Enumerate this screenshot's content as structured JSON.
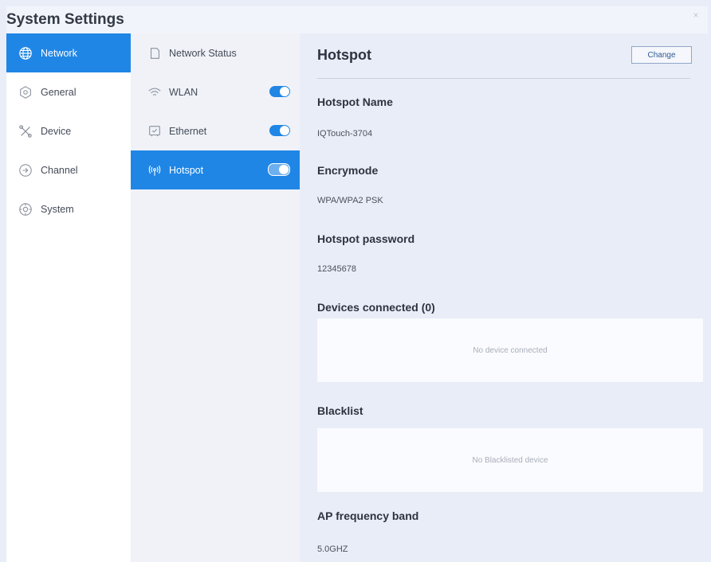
{
  "window": {
    "title": "System Settings",
    "close_label": "×"
  },
  "sidebar": {
    "items": [
      {
        "label": "Network",
        "icon": "globe-icon",
        "active": true
      },
      {
        "label": "General",
        "icon": "general-icon",
        "active": false
      },
      {
        "label": "Device",
        "icon": "device-icon",
        "active": false
      },
      {
        "label": "Channel",
        "icon": "channel-icon",
        "active": false
      },
      {
        "label": "System",
        "icon": "system-icon",
        "active": false
      }
    ]
  },
  "subnav": {
    "items": [
      {
        "label": "Network Status",
        "icon": "network-status-icon"
      },
      {
        "label": "WLAN",
        "icon": "wifi-icon",
        "toggle_on": true
      },
      {
        "label": "Ethernet",
        "icon": "ethernet-icon",
        "toggle_on": true
      },
      {
        "label": "Hotspot",
        "icon": "hotspot-icon",
        "toggle_on": true,
        "active": true
      }
    ]
  },
  "detail": {
    "title": "Hotspot",
    "change_label": "Change",
    "hotspot_name_label": "Hotspot Name",
    "hotspot_name_value": "IQTouch-3704",
    "encrymode_label": "Encrymode",
    "encrymode_value": "WPA/WPA2 PSK",
    "password_label": "Hotspot password",
    "password_value": "12345678",
    "devices_label": "Devices connected (0)",
    "devices_empty": "No device connected",
    "blacklist_label": "Blacklist",
    "blacklist_empty": "No Blacklisted device",
    "band_label": "AP frequency band",
    "band_value": "5.0GHZ"
  },
  "colors": {
    "accent": "#1f86e6",
    "background": "#e9edf8",
    "sidebar": "#ffffff"
  }
}
